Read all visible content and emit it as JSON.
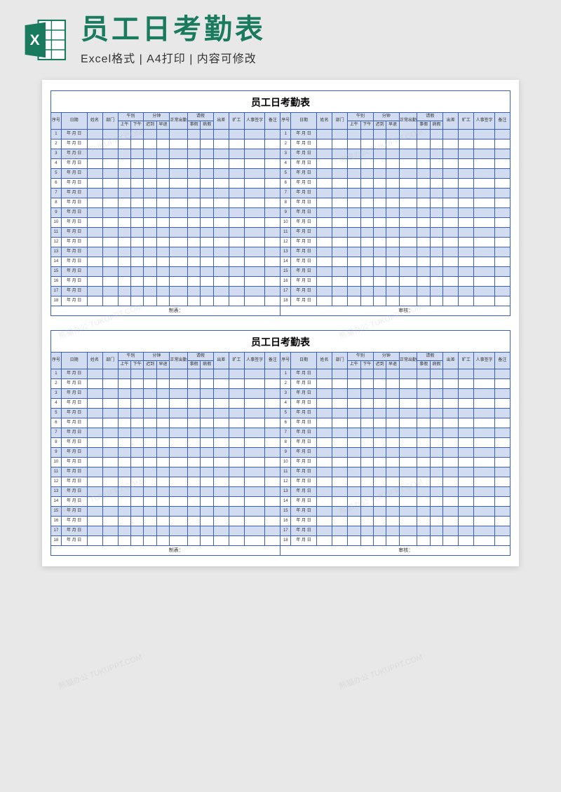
{
  "header": {
    "main_title": "员工日考勤表",
    "sub_title": "Excel格式 | A4打印 | 内容可修改",
    "icon_letter": "X"
  },
  "sheet": {
    "title": "员工日考勤表",
    "columns": {
      "seq": "序号",
      "date": "日期",
      "name": "姓名",
      "dept": "部门",
      "ampm_group": "午别",
      "am": "上午",
      "pm": "下午",
      "minutes_group": "分钟",
      "late": "迟到",
      "early": "早退",
      "normal": "正常出勤",
      "leave_group": "请假",
      "l1": "事假",
      "l2": "病假",
      "travel": "出差",
      "absent": "旷工",
      "hr_sign": "人事签字",
      "remark": "备注"
    },
    "date_placeholder": "年 月 日",
    "row_count": 18,
    "footer": {
      "maker": "制表：",
      "auditor": "审核："
    }
  },
  "watermark_text": "熊猫办公 TUKUPPT.COM"
}
